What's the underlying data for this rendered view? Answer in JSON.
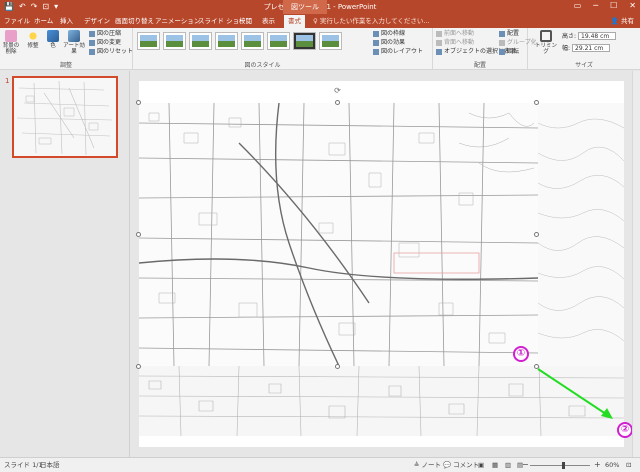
{
  "titlebar": {
    "document_title": "プレゼンテーション1 - PowerPoint",
    "context_group": "図ツール",
    "qat": {
      "save": "💾",
      "undo": "↶",
      "redo": "↷",
      "start": "⊡",
      "customize": "▾"
    },
    "win": {
      "ribbon_opts": "▭",
      "minimize": "─",
      "restore": "☐",
      "close": "✕"
    }
  },
  "tabs": [
    "ファイル",
    "ホーム",
    "挿入",
    "デザイン",
    "画面切り替え",
    "アニメーション",
    "スライド ショー",
    "校閲",
    "表示",
    "書式"
  ],
  "active_tab": "書式",
  "tellme": "♀ 実行したい作業を入力してください...",
  "share": "👤 共有",
  "ribbon": {
    "adjust": {
      "label": "調整",
      "remove_bg": "背景の削除",
      "corrections": "修整",
      "color": "色",
      "artistic": "アート効果",
      "compress": "図の圧縮",
      "change": "図の変更",
      "reset": "図のリセット"
    },
    "styles": {
      "label": "図のスタイル",
      "border": "図の枠線",
      "effects": "図の効果",
      "layout": "図のレイアウト"
    },
    "arrange": {
      "label": "配置",
      "forward": "前面へ移動",
      "backward": "背面へ移動",
      "selection_pane": "オブジェクトの選択と表示",
      "align": "配置",
      "group": "グループ化",
      "rotate": "回転"
    },
    "size": {
      "label": "サイズ",
      "crop": "トリミング",
      "height_label": "高さ:",
      "height": "19.48 cm",
      "width_label": "幅:",
      "width": "29.21 cm"
    }
  },
  "slides_panel": {
    "slide_number": "1"
  },
  "callouts": {
    "one": "①",
    "two": "②"
  },
  "status": {
    "slide": "スライド 1/1",
    "language": "日本語",
    "notes": "≜ ノート",
    "comments": "💬 コメント",
    "minus": "−",
    "plus": "+",
    "zoom": "60%"
  },
  "colors": {
    "accent": "#b7472a",
    "callout": "#d020d0",
    "arrow": "#22dd22"
  }
}
